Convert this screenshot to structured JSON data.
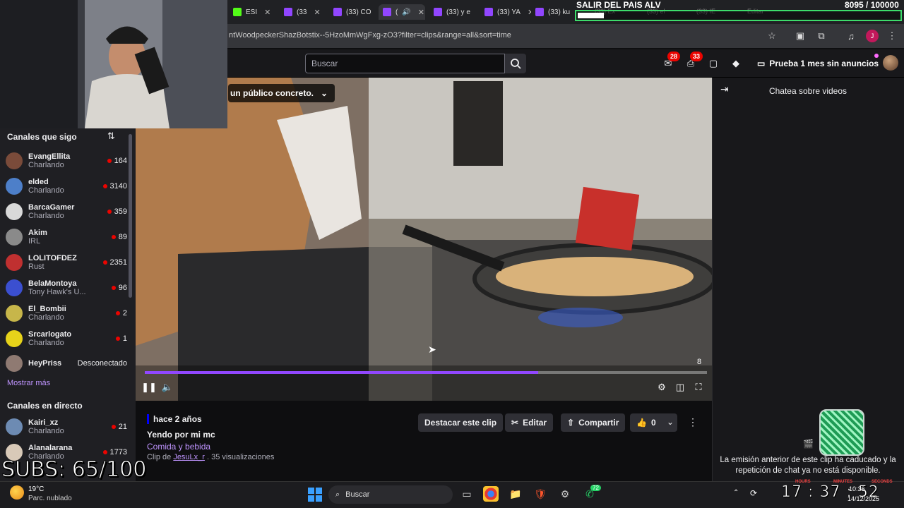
{
  "browser": {
    "tabs": [
      {
        "label": "ESI"
      },
      {
        "label": "(33"
      },
      {
        "label": "(33) CO"
      },
      {
        "label": "("
      },
      {
        "label": "(33) y e"
      },
      {
        "label": "(33) YA"
      },
      {
        "label": "(33) ku"
      }
    ],
    "url": "ntWoodpeckerShazBotstix--5HzoMmWgFxg-zO3?filter=clips&range=all&sort=time"
  },
  "overlay": {
    "goal_title": "SALIR DEL PAIS ALV",
    "goal_count": "8095 / 100000",
    "goal_progress": 0.08,
    "ghost_tabs": [
      "(33) Ex",
      "(33) el",
      "(33) IE",
      "Editar"
    ],
    "subs": "SUBS: 65/100"
  },
  "header": {
    "search_placeholder": "Buscar",
    "inbox_badge": "28",
    "notif_badge": "33",
    "prime_label": "Prueba 1 mes sin anuncios"
  },
  "sidebar": {
    "followed_title": "Canales que sigo",
    "followed": [
      {
        "name": "EvangEllita",
        "game": "Charlando",
        "viewers": "164",
        "color": "#7a4b3a"
      },
      {
        "name": "elded",
        "game": "Charlando",
        "viewers": "3140",
        "color": "#4d7fc9"
      },
      {
        "name": "BarcaGamer",
        "game": "Charlando",
        "viewers": "359",
        "color": "#d9d9d9"
      },
      {
        "name": "Akim",
        "game": "IRL",
        "viewers": "89",
        "color": "#8a8a8a"
      },
      {
        "name": "LOLITOFDEZ",
        "game": "Rust",
        "viewers": "2351",
        "color": "#c03030"
      },
      {
        "name": "BelaMontoya",
        "game": "Tony Hawk's U...",
        "viewers": "96",
        "color": "#3b4fd0"
      },
      {
        "name": "El_Bombii",
        "game": "Charlando",
        "viewers": "2",
        "color": "#c7b64a"
      },
      {
        "name": "Srcarlogato",
        "game": "Charlando",
        "viewers": "1",
        "color": "#e6d21a"
      }
    ],
    "offline": {
      "name": "HeyPriss",
      "status": "Desconectado",
      "color": "#8f7a72"
    },
    "show_more": "Mostrar más",
    "live_title": "Canales en directo",
    "live": [
      {
        "name": "Kairi_xz",
        "game": "Charlando",
        "viewers": "21",
        "color": "#6d8bb3"
      },
      {
        "name": "Alanalarana",
        "game": "Charlando",
        "viewers": "1773",
        "color": "#d8c9b8"
      }
    ]
  },
  "player": {
    "audience_label": "un público concreto.",
    "time": "8",
    "progress": 0.7
  },
  "clip": {
    "ago": "hace 2 años",
    "title": "Yendo por mi mc",
    "category": "Comida y bebida",
    "by_prefix": "Clip de",
    "author": "JesuLx_r",
    "views": ". 35 visualizaciones",
    "btn_highlight": "Destacar este clip",
    "btn_edit": "Editar",
    "btn_share": "Compartir",
    "likes": "0"
  },
  "chat": {
    "title": "Chatea sobre videos",
    "message": "La emisión anterior de este clip ha caducado y la repetición de chat ya no está disponible."
  },
  "taskbar": {
    "temp": "19°C",
    "weather": "Parc. nublado",
    "search": "Buscar",
    "whatsapp_badge": "72",
    "clock_time": "10:36",
    "clock_date": "14/12/2025",
    "timer_h": "17",
    "timer_m": "37",
    "timer_s": "52",
    "timer_labels": [
      "HOURS",
      "MINUTES",
      "SECONDS"
    ]
  }
}
